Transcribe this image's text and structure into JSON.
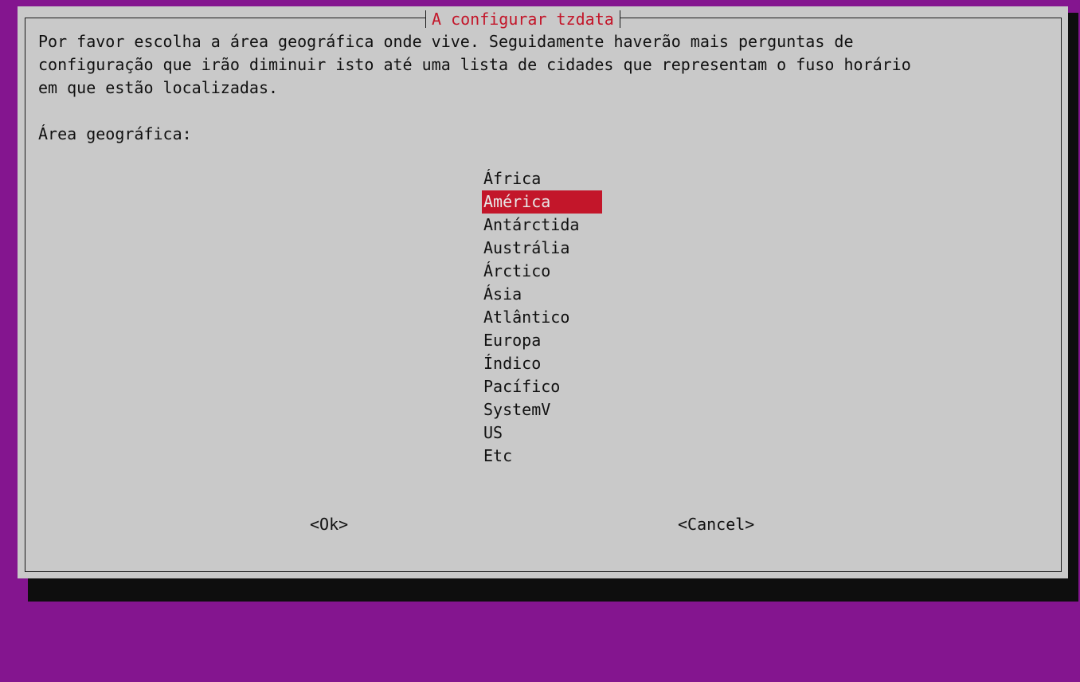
{
  "dialog": {
    "title": "A configurar tzdata",
    "intro": "Por favor escolha a área geográfica onde vive. Seguidamente haverão mais perguntas de\nconfiguração que irão diminuir isto até uma lista de cidades que representam o fuso horário\nem que estão localizadas.",
    "prompt": "Área geográfica:",
    "areas": [
      "África",
      "América",
      "Antárctida",
      "Austrália",
      "Árctico",
      "Ásia",
      "Atlântico",
      "Europa",
      "Índico",
      "Pacífico",
      "SystemV",
      "US",
      "Etc"
    ],
    "selected_area": "América",
    "ok_label": "<Ok>",
    "cancel_label": "<Cancel>"
  },
  "colors": {
    "background": "#84158f",
    "dialog": "#c9c9c9",
    "accent": "#c3162a",
    "shadow": "#0e0e0e"
  }
}
